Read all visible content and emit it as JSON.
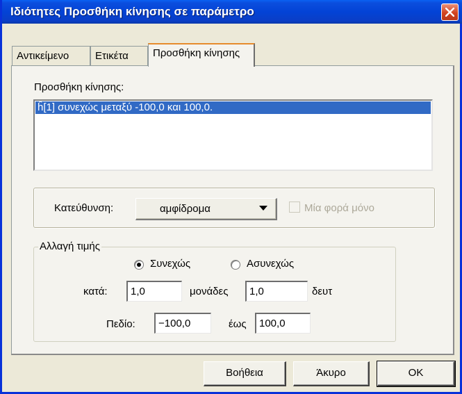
{
  "window": {
    "title": "Ιδιότητες Προσθήκη κίνησης σε παράμετρο"
  },
  "tabs": [
    {
      "label": "Αντικείμενο"
    },
    {
      "label": "Ετικέτα"
    },
    {
      "label": "Προσθήκη κίνησης",
      "active": true
    }
  ],
  "motion": {
    "label": "Προσθήκη κίνησης:",
    "items": [
      "ĥ[1] συνεχώς μεταξύ -100,0 και 100,0."
    ]
  },
  "direction": {
    "label": "Κατεύθυνση:",
    "value": "αμφίδρομα",
    "once_label": "Μία φορά μόνο",
    "once_checked": false
  },
  "value_change": {
    "legend": "Αλλαγή τιμής",
    "continuous_label": "Συνεχώς",
    "discrete_label": "Ασυνεχώς",
    "selected": "continuous",
    "by_label": "κατά:",
    "by_value": "1,0",
    "units_label": "μονάδες",
    "seconds_value": "1,0",
    "seconds_label": "δευτ",
    "domain_label": "Πεδίο:",
    "domain_from": "−100,0",
    "to_label": "έως",
    "domain_to": "100,0"
  },
  "buttons": {
    "help": "Βοήθεια",
    "cancel": "Άκυρο",
    "ok": "OK"
  },
  "colors": {
    "titlebar": "#0a3ec6",
    "selection": "#316ac5",
    "active_tab_accent": "#e68b2c"
  }
}
